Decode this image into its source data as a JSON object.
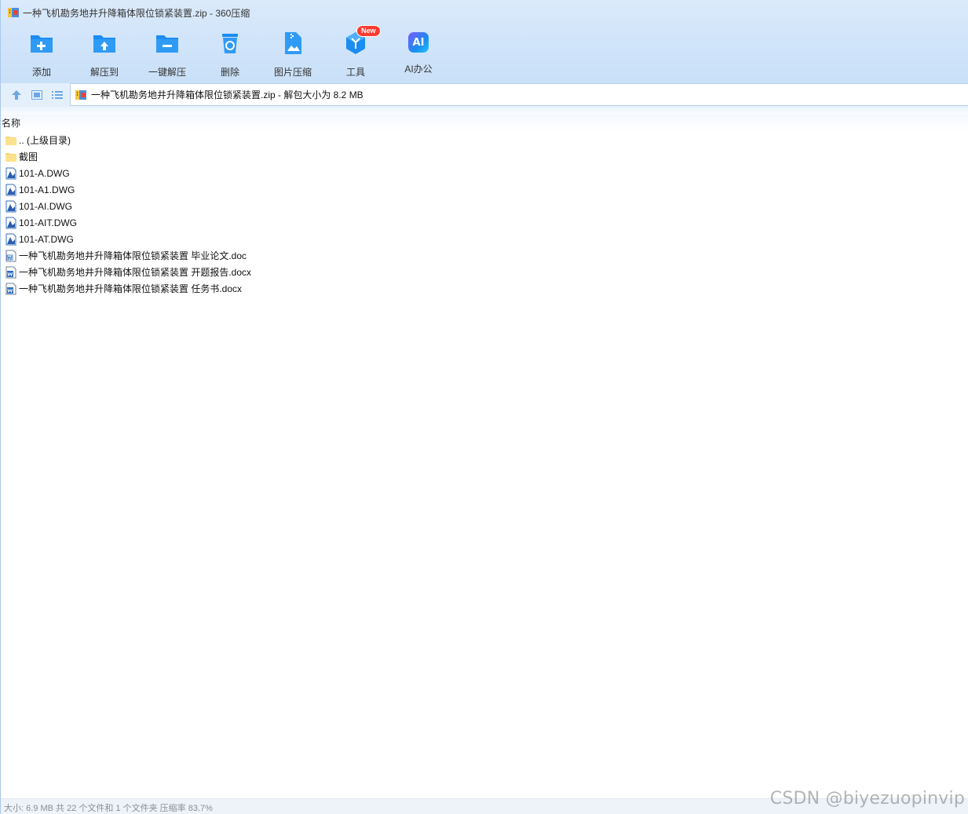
{
  "window": {
    "title": "一种飞机勘务地井升降箱体限位锁紧装置.zip - 360压缩"
  },
  "toolbar": {
    "items": [
      {
        "label": "添加",
        "icon": "add-folder-icon"
      },
      {
        "label": "解压到",
        "icon": "extract-to-icon"
      },
      {
        "label": "一键解压",
        "icon": "one-click-extract-icon"
      },
      {
        "label": "删除",
        "icon": "delete-bin-icon"
      },
      {
        "label": "图片压缩",
        "icon": "image-compress-icon"
      },
      {
        "label": "工具",
        "icon": "tools-icon",
        "badge": "New"
      },
      {
        "label": "AI办公",
        "icon": "ai-office-icon",
        "icon_text": "AI"
      }
    ]
  },
  "address": {
    "path": "一种飞机勘务地井升降箱体限位锁紧装置.zip - 解包大小为 8.2 MB"
  },
  "list": {
    "column_name": "名称",
    "files": [
      {
        "name": ".. (上级目录)",
        "type": "folder"
      },
      {
        "name": "截图",
        "type": "folder"
      },
      {
        "name": "101-A.DWG",
        "type": "dwg"
      },
      {
        "name": "101-A1.DWG",
        "type": "dwg"
      },
      {
        "name": "101-AI.DWG",
        "type": "dwg"
      },
      {
        "name": "101-AIT.DWG",
        "type": "dwg"
      },
      {
        "name": "101-AT.DWG",
        "type": "dwg"
      },
      {
        "name": "一种飞机勘务地井升降箱体限位锁紧装置 毕业论文.doc",
        "type": "doc"
      },
      {
        "name": "一种飞机勘务地井升降箱体限位锁紧装置 开题报告.docx",
        "type": "docx"
      },
      {
        "name": "一种飞机勘务地井升降箱体限位锁紧装置 任务书.docx",
        "type": "docx"
      }
    ]
  },
  "status": {
    "text": "大小: 6.9 MB 共 22 个文件和 1 个文件夹 压缩率 83.7%"
  },
  "watermark": "CSDN @biyezuopinvip",
  "colors": {
    "accent": "#1b8cf0",
    "badge": "#ff3b30",
    "folder": "#f7d774"
  }
}
